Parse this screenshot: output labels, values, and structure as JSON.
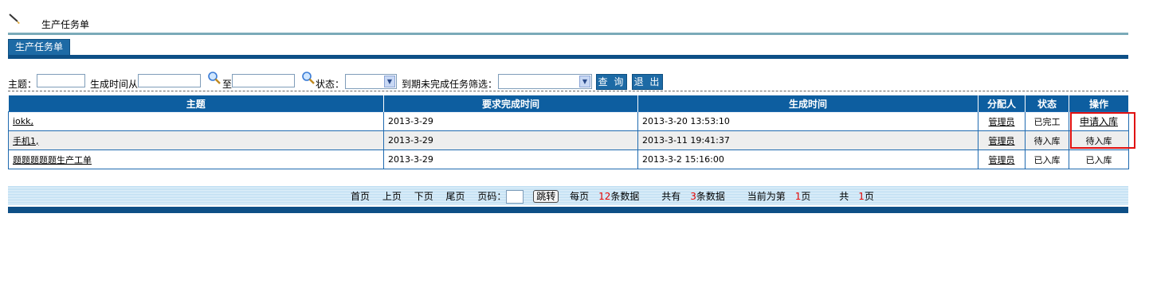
{
  "header": {
    "title": "生产任务单",
    "icon": "pen-icon"
  },
  "tab": {
    "label": "生产任务单"
  },
  "filters": {
    "subject_label": "主题：",
    "created_from_label": "生成时间从",
    "to_label": "至",
    "status_label": "状态：",
    "status_value": "",
    "due_filter_label": "到期未完成任务筛选：",
    "due_filter_value": "",
    "query_button": "查 询",
    "exit_button": "退 出"
  },
  "table": {
    "columns": [
      "主题",
      "要求完成时间",
      "生成时间",
      "分配人",
      "状态",
      "操作"
    ],
    "rows": [
      {
        "subject": "iokk,",
        "due": "2013-3-29",
        "created": "2013-3-20 13:53:10",
        "assignee": "管理员",
        "status": "已完工",
        "action": "申请入库"
      },
      {
        "subject": "手机1,",
        "due": "2013-3-29",
        "created": "2013-3-11 19:41:37",
        "assignee": "管理员",
        "status": "待入库",
        "action": "待入库"
      },
      {
        "subject": "题题题题题生产工单",
        "due": "2013-3-29",
        "created": "2013-3-2 15:16:00",
        "assignee": "管理员",
        "status": "已入库",
        "action": "已入库"
      }
    ]
  },
  "pager": {
    "first": "首页",
    "prev": "上页",
    "next": "下页",
    "last": "尾页",
    "page_label": "页码：",
    "go_button": "跳转",
    "per_page_pre": "每页",
    "per_page": "12",
    "per_page_post": "条数据",
    "total_pre": "共有",
    "total": "3",
    "total_post": "条数据",
    "current_pre": "当前为第",
    "current": "1",
    "current_post": "页",
    "pages_pre": "共",
    "pages": "1",
    "pages_post": "页"
  },
  "colors": {
    "header_blue": "#0d5ea0",
    "dark_blue": "#0d4f86",
    "highlight": "#e01010",
    "page_number_red": "#dd0000"
  }
}
